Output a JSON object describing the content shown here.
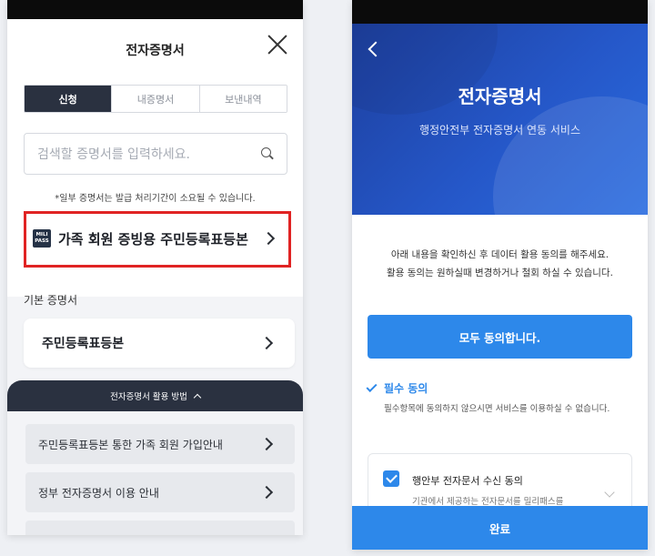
{
  "left": {
    "header": {
      "title": "전자증명서"
    },
    "tabs": [
      {
        "label": "신청",
        "active": true
      },
      {
        "label": "내증명서",
        "active": false
      },
      {
        "label": "보낸내역",
        "active": false
      }
    ],
    "search": {
      "placeholder": "검색할 증명서를 입력하세요."
    },
    "notice": "*일부 증명서는 발급 처리기간이 소요될 수 있습니다.",
    "featured": {
      "badge_line1": "MILI",
      "badge_line2": "PASS",
      "label": "가족 회원 증빙용 주민등록표등본"
    },
    "section_title": "기본 증명서",
    "main_card": {
      "label": "주민등록표등본"
    },
    "sheet": {
      "header": "전자증명서 활용 방법",
      "items": [
        {
          "label": "주민등록표등본 통한 가족 회원 가입안내"
        },
        {
          "label": "정부 전자증명서 이용 안내"
        }
      ]
    }
  },
  "right": {
    "hero": {
      "title": "전자증명서",
      "subtitle": "행정안전부 전자증명서 연동 서비스"
    },
    "intro_line1": "아래 내용을 확인하신 후 데이터 활용 동의를 해주세요.",
    "intro_line2": "활용 동의는 원하실때 변경하거나 철회 하실 수 있습니다.",
    "agree_all": "모두 동의합니다.",
    "required": {
      "label": "필수 동의",
      "desc": "필수항목에 동의하지 않으시면 서비스를 이용하실 수 없습니다."
    },
    "consent": {
      "title": "행안부 전자문서 수신 동의",
      "desc": "기관에서 제공하는 전자문서를 밀리패스를"
    },
    "done": "완료"
  },
  "colors": {
    "accent_blue": "#2d88ea",
    "dark_navy": "#2a3140",
    "highlight_red": "#e02323",
    "hero_blue": "#2557c8"
  }
}
